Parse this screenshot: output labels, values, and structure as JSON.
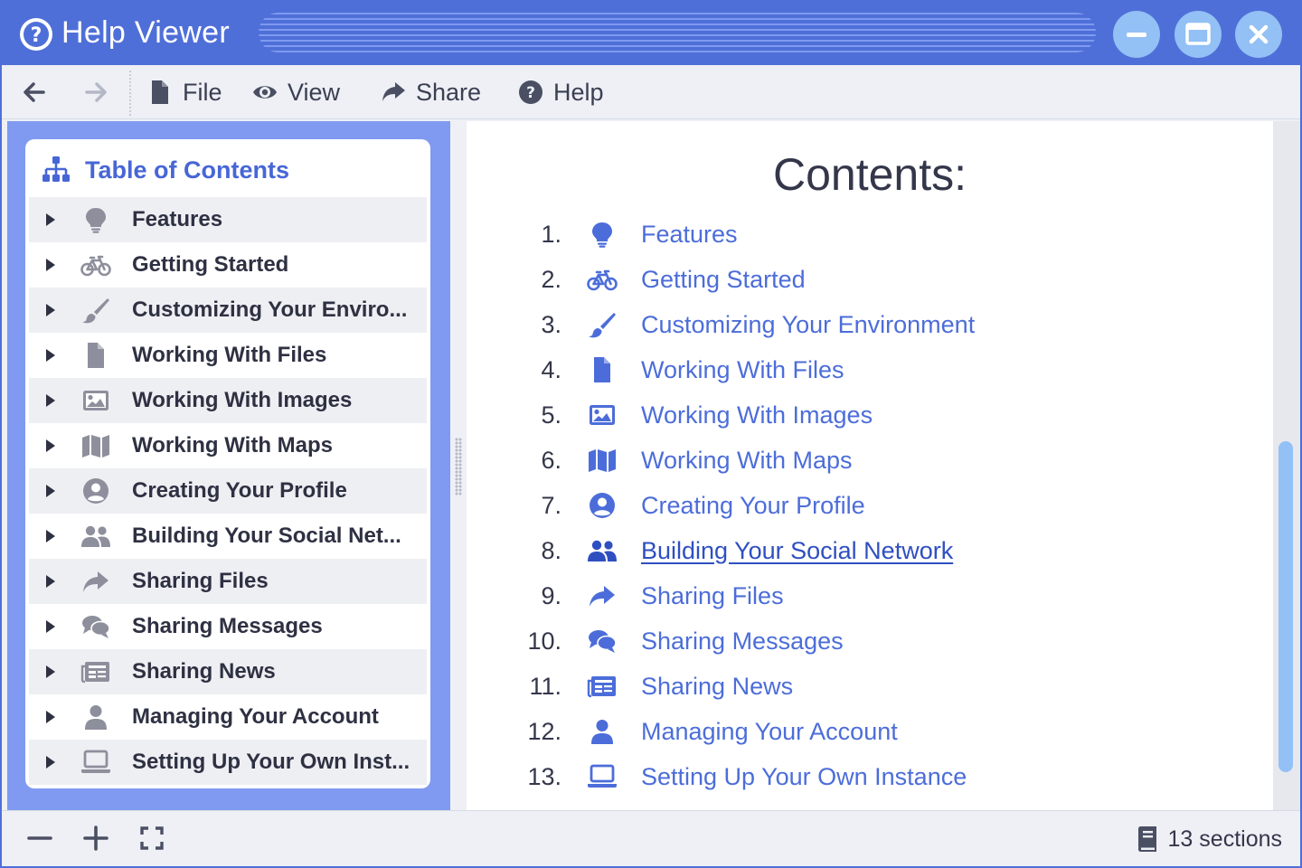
{
  "window": {
    "title": "Help Viewer"
  },
  "toolbar": {
    "menus": [
      {
        "label": "File",
        "icon": "file-icon"
      },
      {
        "label": "View",
        "icon": "eye-icon"
      },
      {
        "label": "Share",
        "icon": "share-icon"
      },
      {
        "label": "Help",
        "icon": "help-icon"
      }
    ]
  },
  "toc": {
    "title": "Table of Contents",
    "items": [
      {
        "label": "Features",
        "icon": "lightbulb-icon"
      },
      {
        "label": "Getting Started",
        "icon": "bicycle-icon"
      },
      {
        "label": "Customizing Your Enviro...",
        "icon": "paintbrush-icon"
      },
      {
        "label": "Working With Files",
        "icon": "file-icon"
      },
      {
        "label": "Working With Images",
        "icon": "image-icon"
      },
      {
        "label": "Working With Maps",
        "icon": "map-icon"
      },
      {
        "label": "Creating Your Profile",
        "icon": "user-circle-icon"
      },
      {
        "label": "Building Your Social Net...",
        "icon": "users-icon"
      },
      {
        "label": "Sharing Files",
        "icon": "share-icon"
      },
      {
        "label": "Sharing Messages",
        "icon": "comments-icon"
      },
      {
        "label": "Sharing News",
        "icon": "newspaper-icon"
      },
      {
        "label": "Managing Your Account",
        "icon": "user-icon"
      },
      {
        "label": "Setting Up Your Own Inst...",
        "icon": "laptop-icon"
      }
    ]
  },
  "content": {
    "heading": "Contents:",
    "active_index": 7,
    "items": [
      {
        "num": "1.",
        "label": "Features",
        "icon": "lightbulb-icon"
      },
      {
        "num": "2.",
        "label": "Getting Started",
        "icon": "bicycle-icon"
      },
      {
        "num": "3.",
        "label": "Customizing Your Environment",
        "icon": "paintbrush-icon"
      },
      {
        "num": "4.",
        "label": "Working With Files",
        "icon": "file-icon"
      },
      {
        "num": "5.",
        "label": "Working With Images",
        "icon": "image-icon"
      },
      {
        "num": "6.",
        "label": "Working With Maps",
        "icon": "map-icon"
      },
      {
        "num": "7.",
        "label": "Creating Your Profile",
        "icon": "user-circle-icon"
      },
      {
        "num": "8.",
        "label": "Building Your Social Network",
        "icon": "users-icon"
      },
      {
        "num": "9.",
        "label": "Sharing Files",
        "icon": "share-icon"
      },
      {
        "num": "10.",
        "label": "Sharing Messages",
        "icon": "comments-icon"
      },
      {
        "num": "11.",
        "label": "Sharing News",
        "icon": "newspaper-icon"
      },
      {
        "num": "12.",
        "label": "Managing Your Account",
        "icon": "user-icon"
      },
      {
        "num": "13.",
        "label": "Setting Up Your Own Instance",
        "icon": "laptop-icon"
      }
    ]
  },
  "statusbar": {
    "section_count": "13 sections"
  },
  "colors": {
    "accent": "#4f6fd8",
    "link": "#4c6dd9",
    "link_active": "#2f4fc1",
    "panel": "#7f9af0",
    "scroll_thumb": "#93c0f5",
    "text": "#34374a",
    "toc_icon": "#8e8f9c"
  }
}
